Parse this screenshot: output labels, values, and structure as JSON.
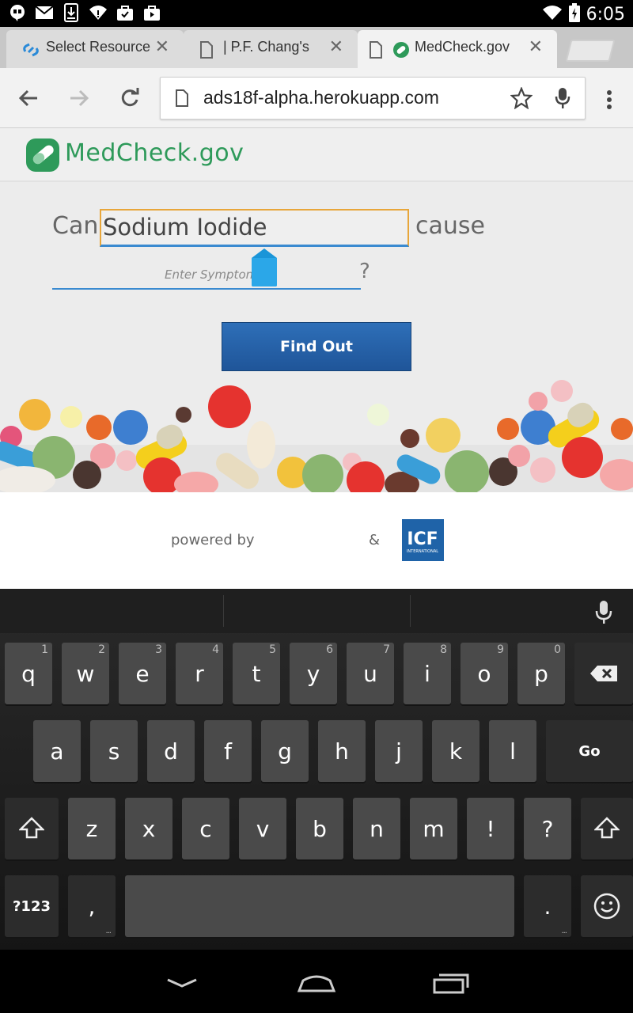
{
  "status_bar": {
    "time": "6:05",
    "left_icons": [
      "hangouts-icon",
      "gmail-icon",
      "download-icon",
      "wifi-alert-icon",
      "bag-icon",
      "briefcase-icon"
    ],
    "right_icons": [
      "wifi-icon",
      "battery-icon"
    ]
  },
  "browser": {
    "tabs": [
      {
        "title": "Select Resource",
        "favicon": "link-icon",
        "active": false
      },
      {
        "title": "| P.F. Chang's",
        "favicon": "page-icon",
        "active": false
      },
      {
        "title": "MedCheck.gov",
        "favicon": "medcheck-icon",
        "active": true
      }
    ],
    "url": "ads18f-alpha.herokuapp.com"
  },
  "page": {
    "logo_text": "MedCheck.gov",
    "question_prefix": "Can",
    "drug_value": "Sodium Iodide",
    "question_suffix": "cause",
    "symptom_placeholder": "Enter Symptom",
    "question_mark": "?",
    "find_button": "Find Out",
    "powered_by": "powered by",
    "ampersand": "&",
    "partner_logo": "ICF",
    "partner_logo_sub": "INTERNATIONAL"
  },
  "keyboard": {
    "row1": [
      {
        "k": "q",
        "h": "1"
      },
      {
        "k": "w",
        "h": "2"
      },
      {
        "k": "e",
        "h": "3"
      },
      {
        "k": "r",
        "h": "4"
      },
      {
        "k": "t",
        "h": "5"
      },
      {
        "k": "y",
        "h": "6"
      },
      {
        "k": "u",
        "h": "7"
      },
      {
        "k": "i",
        "h": "8"
      },
      {
        "k": "o",
        "h": "9"
      },
      {
        "k": "p",
        "h": "0"
      }
    ],
    "row2": [
      "a",
      "s",
      "d",
      "f",
      "g",
      "h",
      "j",
      "k",
      "l"
    ],
    "go": "Go",
    "row3": [
      "z",
      "x",
      "c",
      "v",
      "b",
      "n",
      "m",
      "!",
      "?"
    ],
    "symbols": "?123",
    "comma": ",",
    "period": "."
  },
  "colors": {
    "brand_green": "#2e9a5a",
    "button_blue": "#1f5599",
    "focus_orange": "#e8a63a",
    "underline_blue": "#3a8ad0"
  }
}
